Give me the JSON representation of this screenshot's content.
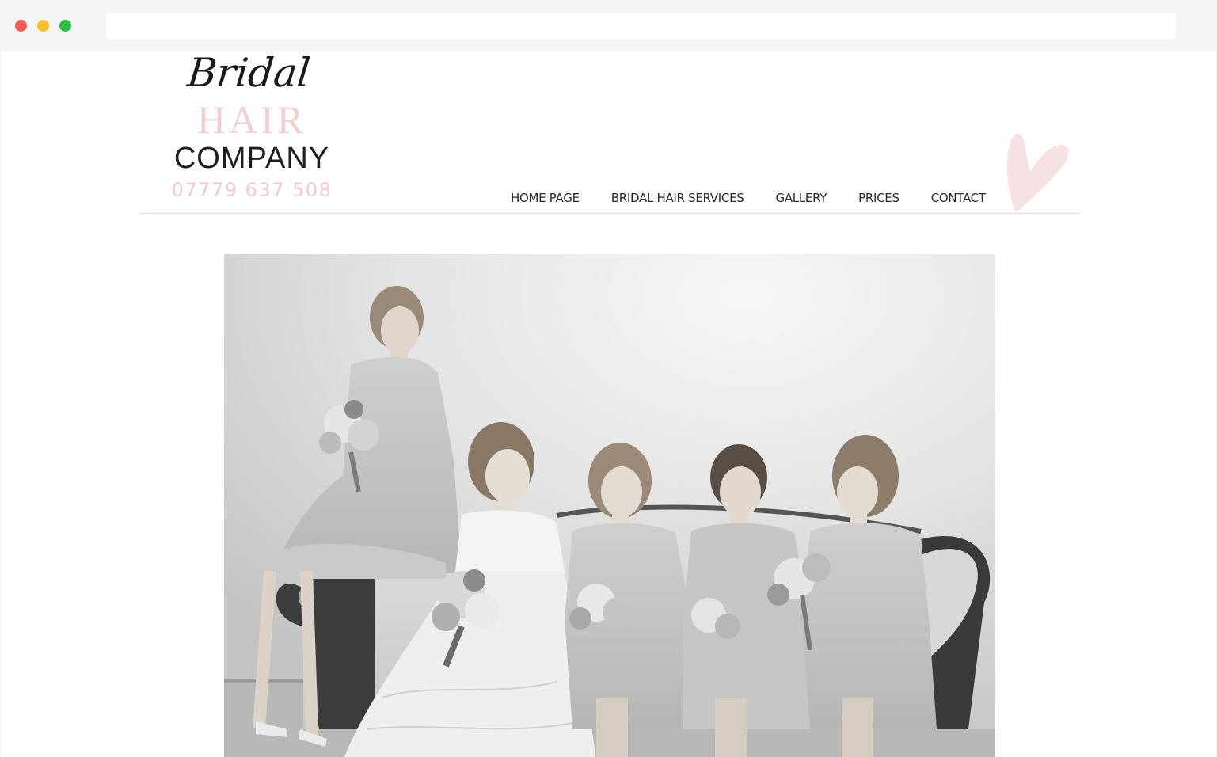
{
  "logo": {
    "script_word": "Bridal",
    "word_two": "HAIR",
    "word_three": "COMPANY",
    "phone": "07779 637 508"
  },
  "nav": {
    "items": [
      {
        "label": "HOME PAGE"
      },
      {
        "label": "BRIDAL HAIR SERVICES"
      },
      {
        "label": "GALLERY"
      },
      {
        "label": "PRICES"
      },
      {
        "label": "CONTACT"
      }
    ]
  },
  "colors": {
    "accent_pink": "#f2cfd1",
    "text_dark": "#2a2a2a",
    "divider": "#f3d6d8"
  },
  "icons": {
    "heart": "heart-icon"
  }
}
